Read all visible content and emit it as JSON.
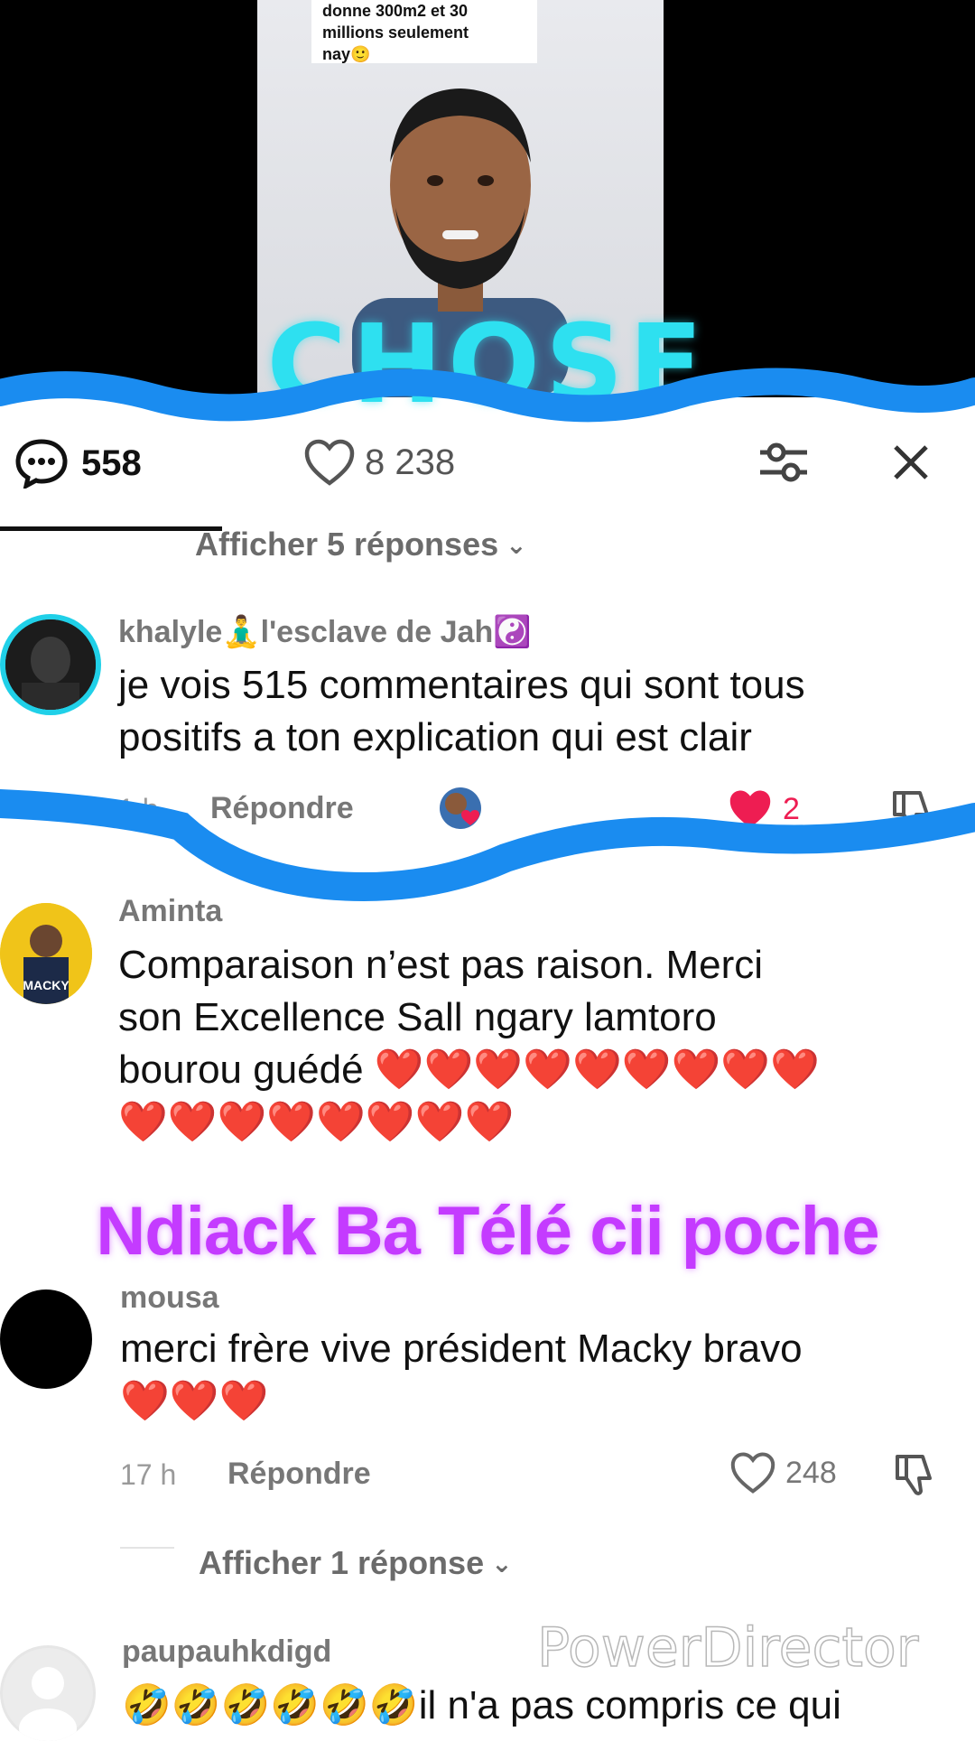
{
  "video": {
    "caption_lines": [
      "donne 300m2 et 30",
      "millions seulement",
      "nay🙂"
    ],
    "big_word": "CHOSE"
  },
  "header": {
    "comment_count": "558",
    "like_count": "8 238",
    "icons": {
      "comments": "comment-bubble-icon",
      "likes": "heart-outline-icon",
      "filter": "sliders-icon",
      "close": "close-icon"
    }
  },
  "comments": [
    {
      "show_replies_label": "Afficher 5 réponses",
      "username": "khalyle🧘‍♂️l'esclave de Jah☯️",
      "text_lines": [
        "je vois 515 commentaires qui sont tous",
        "positifs a ton explication qui est clair"
      ],
      "time": "1 h",
      "reply_label": "Répondre",
      "likes": "2",
      "liked": true
    },
    {
      "username": "Aminta",
      "text_lines": [
        "Comparaison n’est pas raison. Merci",
        "son Excellence Sall ngary lamtoro",
        "bourou guédé ❤️❤️❤️❤️❤️❤️❤️❤️❤️",
        "❤️❤️❤️❤️❤️❤️❤️❤️"
      ],
      "avatar_text": "MACKY"
    },
    {
      "username": "mousa",
      "text_lines": [
        "merci frère vive président Macky bravo",
        "❤️❤️❤️"
      ],
      "time": "17 h",
      "reply_label": "Répondre",
      "likes": "248",
      "show_replies_label": "Afficher 1 réponse"
    },
    {
      "username": "paupauhkdigd",
      "text_lines": [
        "🤣🤣🤣🤣🤣🤣il n'a pas compris ce qui"
      ]
    }
  ],
  "overlay_title": "Ndiack Ba Télé cii poche",
  "watermark": "PowerDirector",
  "colors": {
    "accent_blue": "#1a8cf0",
    "cyan_text": "#2ee0f0",
    "purple_text": "#c43bff",
    "heart_red": "#ee1d52"
  }
}
